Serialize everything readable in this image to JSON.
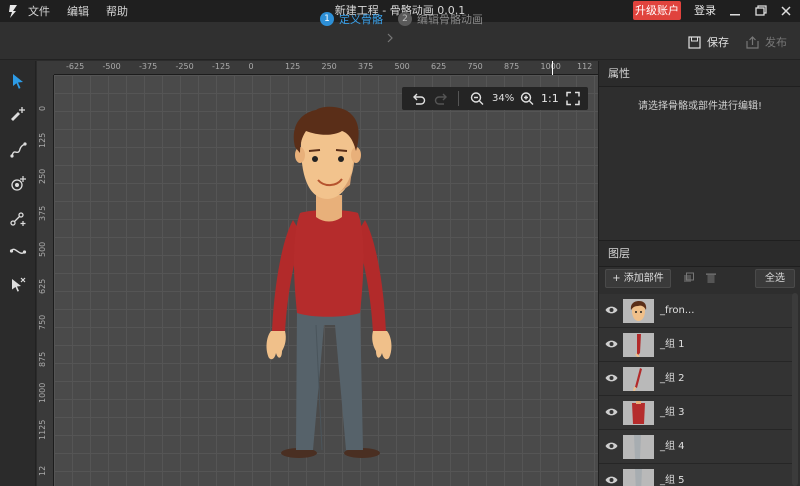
{
  "menu": [
    "文件",
    "编辑",
    "帮助"
  ],
  "window_title": "新建工程 - 骨骼动画 0.0.1",
  "upgrade_label": "升级账户",
  "login_label": "登录",
  "steps": [
    {
      "num": "1",
      "label": "定义骨骼",
      "active": true
    },
    {
      "num": "2",
      "label": "编辑骨骼动画",
      "active": false
    }
  ],
  "save_label": "保存",
  "publish_label": "发布",
  "ruler_top": [
    "-625",
    "-500",
    "-375",
    "-250",
    "-125",
    "0",
    "125",
    "250",
    "375",
    "500",
    "625",
    "750",
    "875",
    "1000",
    "112"
  ],
  "ruler_left": [
    "0",
    "125",
    "250",
    "375",
    "500",
    "625",
    "750",
    "875",
    "1000",
    "1125",
    "12"
  ],
  "zoom": {
    "value": "34%",
    "ratio_label": "1:1"
  },
  "properties": {
    "title": "属性",
    "hint": "请选择骨骼或部件进行编辑!"
  },
  "layers": {
    "title": "图层",
    "add_label": "添加部件",
    "select_all_label": "全选",
    "items": [
      {
        "name": "_fron...",
        "thumb": "face"
      },
      {
        "name": "_组 1",
        "thumb": "arm-red"
      },
      {
        "name": "_组 2",
        "thumb": "arm-red2"
      },
      {
        "name": "_组 3",
        "thumb": "torso"
      },
      {
        "name": "_组 4",
        "thumb": "leg"
      },
      {
        "name": "_组 5",
        "thumb": "leg2"
      }
    ]
  },
  "colors": {
    "accent": "#2d8fd6",
    "upgrade": "#e0433d",
    "canvas": "#4a4a4a"
  },
  "tools": [
    "select-icon",
    "add-bone-icon",
    "path-icon",
    "add-joint-icon",
    "bind-icon",
    "curve-icon",
    "remove-select-icon"
  ]
}
